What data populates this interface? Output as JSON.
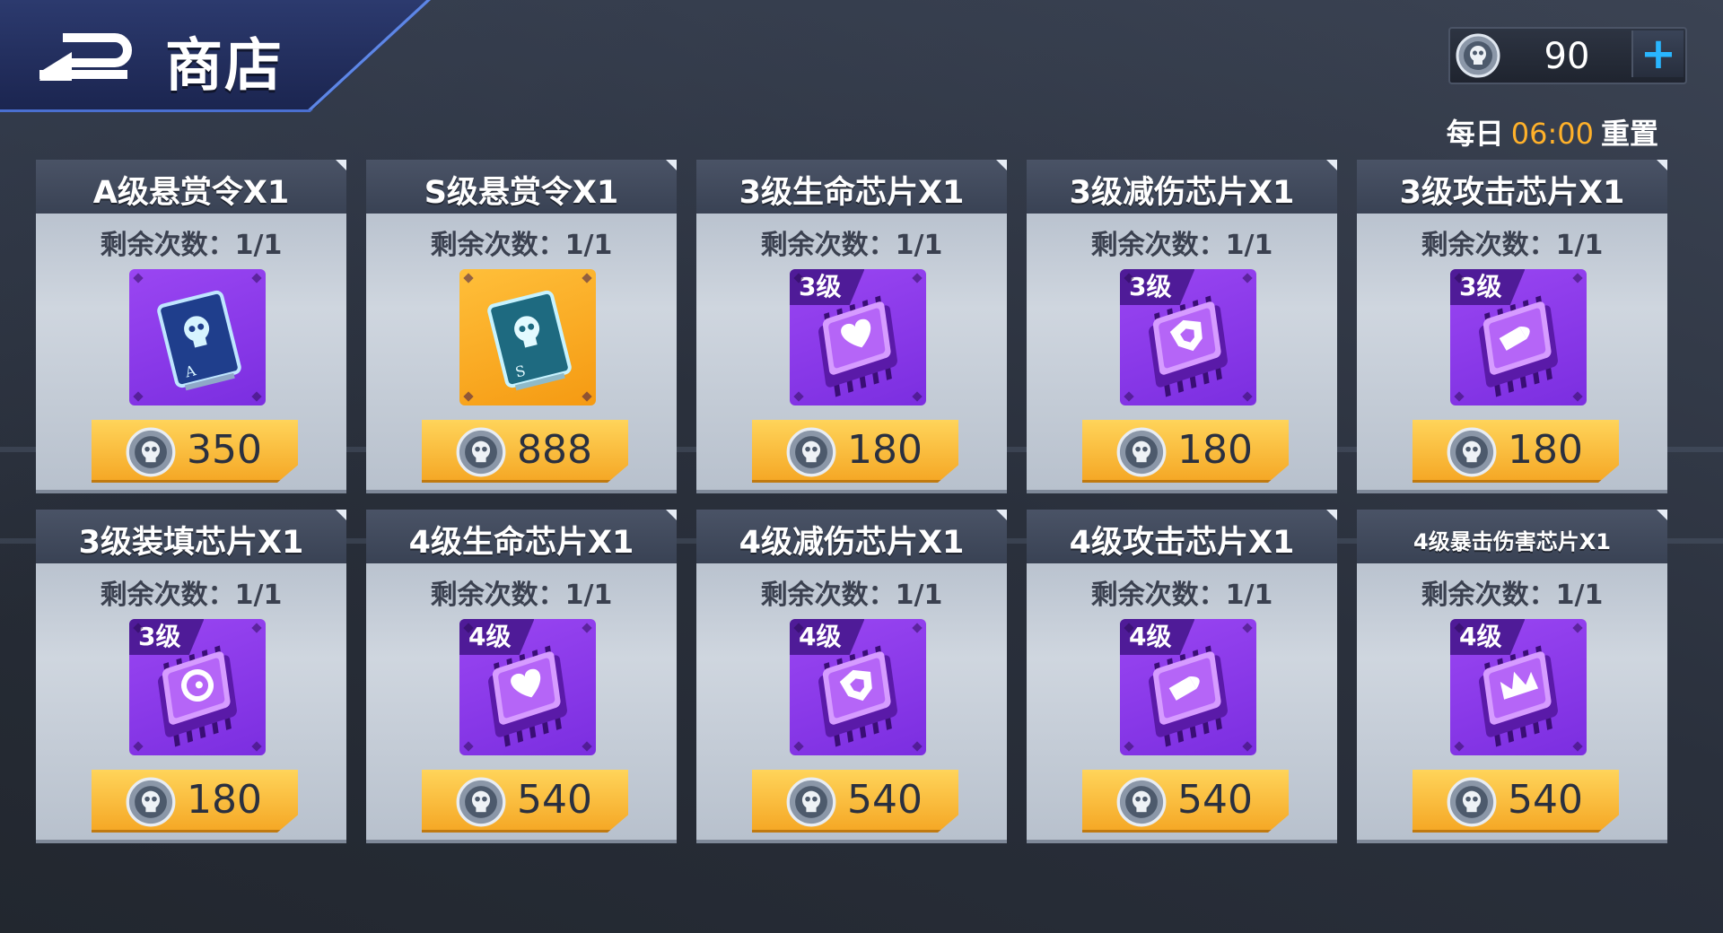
{
  "header": {
    "title": "商店"
  },
  "currency": {
    "amount": "90",
    "plus": "+"
  },
  "reset": {
    "prefix": "每日",
    "time": "06:00",
    "suffix": "重置"
  },
  "colors": {
    "accent": "#29b6ff",
    "price_button": "#f5a826",
    "chip_purple": "#8a3be8",
    "card_gold": "#f59a12",
    "reset_time": "#ffb12a"
  },
  "cards": [
    {
      "name": "A级悬赏令X1",
      "remain": "剩余次数：1/1",
      "price": "350",
      "icon": "bounty-card-a-icon",
      "bg": "purple",
      "tier": ""
    },
    {
      "name": "S级悬赏令X1",
      "remain": "剩余次数：1/1",
      "price": "888",
      "icon": "bounty-card-s-icon",
      "bg": "gold",
      "tier": ""
    },
    {
      "name": "3级生命芯片X1",
      "remain": "剩余次数：1/1",
      "price": "180",
      "icon": "heart-chip-icon",
      "bg": "purple",
      "tier": "3级"
    },
    {
      "name": "3级减伤芯片X1",
      "remain": "剩余次数：1/1",
      "price": "180",
      "icon": "shield-chip-icon",
      "bg": "purple",
      "tier": "3级"
    },
    {
      "name": "3级攻击芯片X1",
      "remain": "剩余次数：1/1",
      "price": "180",
      "icon": "bullet-chip-icon",
      "bg": "purple",
      "tier": "3级"
    },
    {
      "name": "3级装填芯片X1",
      "remain": "剩余次数：1/1",
      "price": "180",
      "icon": "reload-chip-icon",
      "bg": "purple",
      "tier": "3级"
    },
    {
      "name": "4级生命芯片X1",
      "remain": "剩余次数：1/1",
      "price": "540",
      "icon": "heart-chip-icon",
      "bg": "purple",
      "tier": "4级"
    },
    {
      "name": "4级减伤芯片X1",
      "remain": "剩余次数：1/1",
      "price": "540",
      "icon": "shield-chip-icon",
      "bg": "purple",
      "tier": "4级"
    },
    {
      "name": "4级攻击芯片X1",
      "remain": "剩余次数：1/1",
      "price": "540",
      "icon": "bullet-chip-icon",
      "bg": "purple",
      "tier": "4级"
    },
    {
      "name": "4级暴击伤害芯片X1",
      "remain": "剩余次数：1/1",
      "price": "540",
      "icon": "crown-chip-icon",
      "bg": "purple",
      "tier": "4级"
    }
  ]
}
